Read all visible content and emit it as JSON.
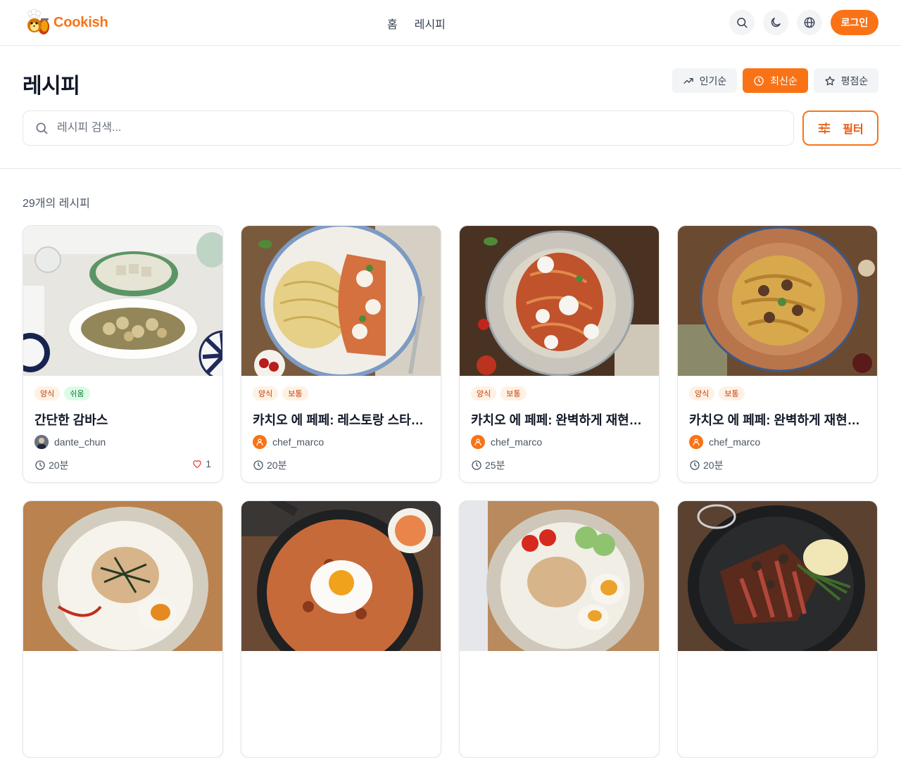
{
  "app": {
    "brand": "Cookish"
  },
  "nav": {
    "home": "홈",
    "recipes": "레시피"
  },
  "header": {
    "login_label": "로그인"
  },
  "page": {
    "title": "레시피"
  },
  "sort": {
    "popular": "인기순",
    "latest": "최신순",
    "rating": "평점순",
    "active": "latest"
  },
  "search": {
    "placeholder": "레시피 검색...",
    "value": ""
  },
  "filter": {
    "label": "필터"
  },
  "results": {
    "count_text": "29개의 레시피"
  },
  "colors": {
    "accent": "#f97316",
    "accent_dark": "#ea580c"
  },
  "cards": [
    {
      "tags": [
        "양식",
        "쉬움"
      ],
      "title": "간단한 감바스",
      "author": "dante_chun",
      "time": "20분",
      "likes": "1",
      "photo": "gambas-dish"
    },
    {
      "tags": [
        "양식",
        "보통"
      ],
      "title": "카치오 에 페페: 레스토랑 스타일 ...",
      "author": "chef_marco",
      "time": "20분",
      "photo": "pasta-pizza"
    },
    {
      "tags": [
        "양식",
        "보통"
      ],
      "title": "카치오 에 페페: 완벽하게 재현한 ...",
      "author": "chef_marco",
      "time": "25분",
      "photo": "tomato-pasta"
    },
    {
      "tags": [
        "양식",
        "보통"
      ],
      "title": "카치오 에 페페: 완벽하게 재현한 ...",
      "author": "chef_marco",
      "time": "20분",
      "photo": "ragu-pasta"
    },
    {
      "photo": "tuna-mayo-rice-bowl"
    },
    {
      "photo": "kimchi-fried-rice"
    },
    {
      "photo": "tuna-bowl-with-egg"
    },
    {
      "photo": "steak-with-truffle"
    }
  ]
}
